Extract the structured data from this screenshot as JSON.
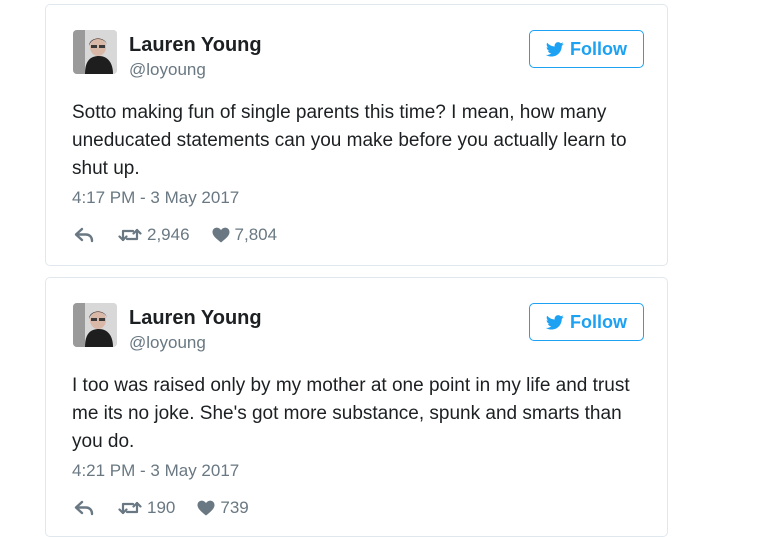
{
  "tweets": [
    {
      "author_name": "Lauren Young",
      "author_handle": "@loyoung",
      "follow_label": "Follow",
      "text": "Sotto making fun of single parents this time? I mean, how many uneducated statements can you make before you actually learn to shut up.",
      "timestamp": "4:17 PM - 3 May 2017",
      "retweets": "2,946",
      "likes": "7,804"
    },
    {
      "author_name": "Lauren Young",
      "author_handle": "@loyoung",
      "follow_label": "Follow",
      "text": "I too was raised only by my mother at one point in my life and trust me its no joke. She's got more substance, spunk and smarts than you do.",
      "timestamp": "4:21 PM - 3 May 2017",
      "retweets": "190",
      "likes": "739"
    }
  ],
  "icons": {
    "follow": "twitter-bird-icon",
    "reply": "reply-arrow-icon",
    "retweet": "retweet-icon",
    "like": "heart-icon"
  },
  "colors": {
    "accent": "#1da1f2",
    "text": "#1c2022",
    "muted": "#697882",
    "border": "#e1e8ed"
  }
}
